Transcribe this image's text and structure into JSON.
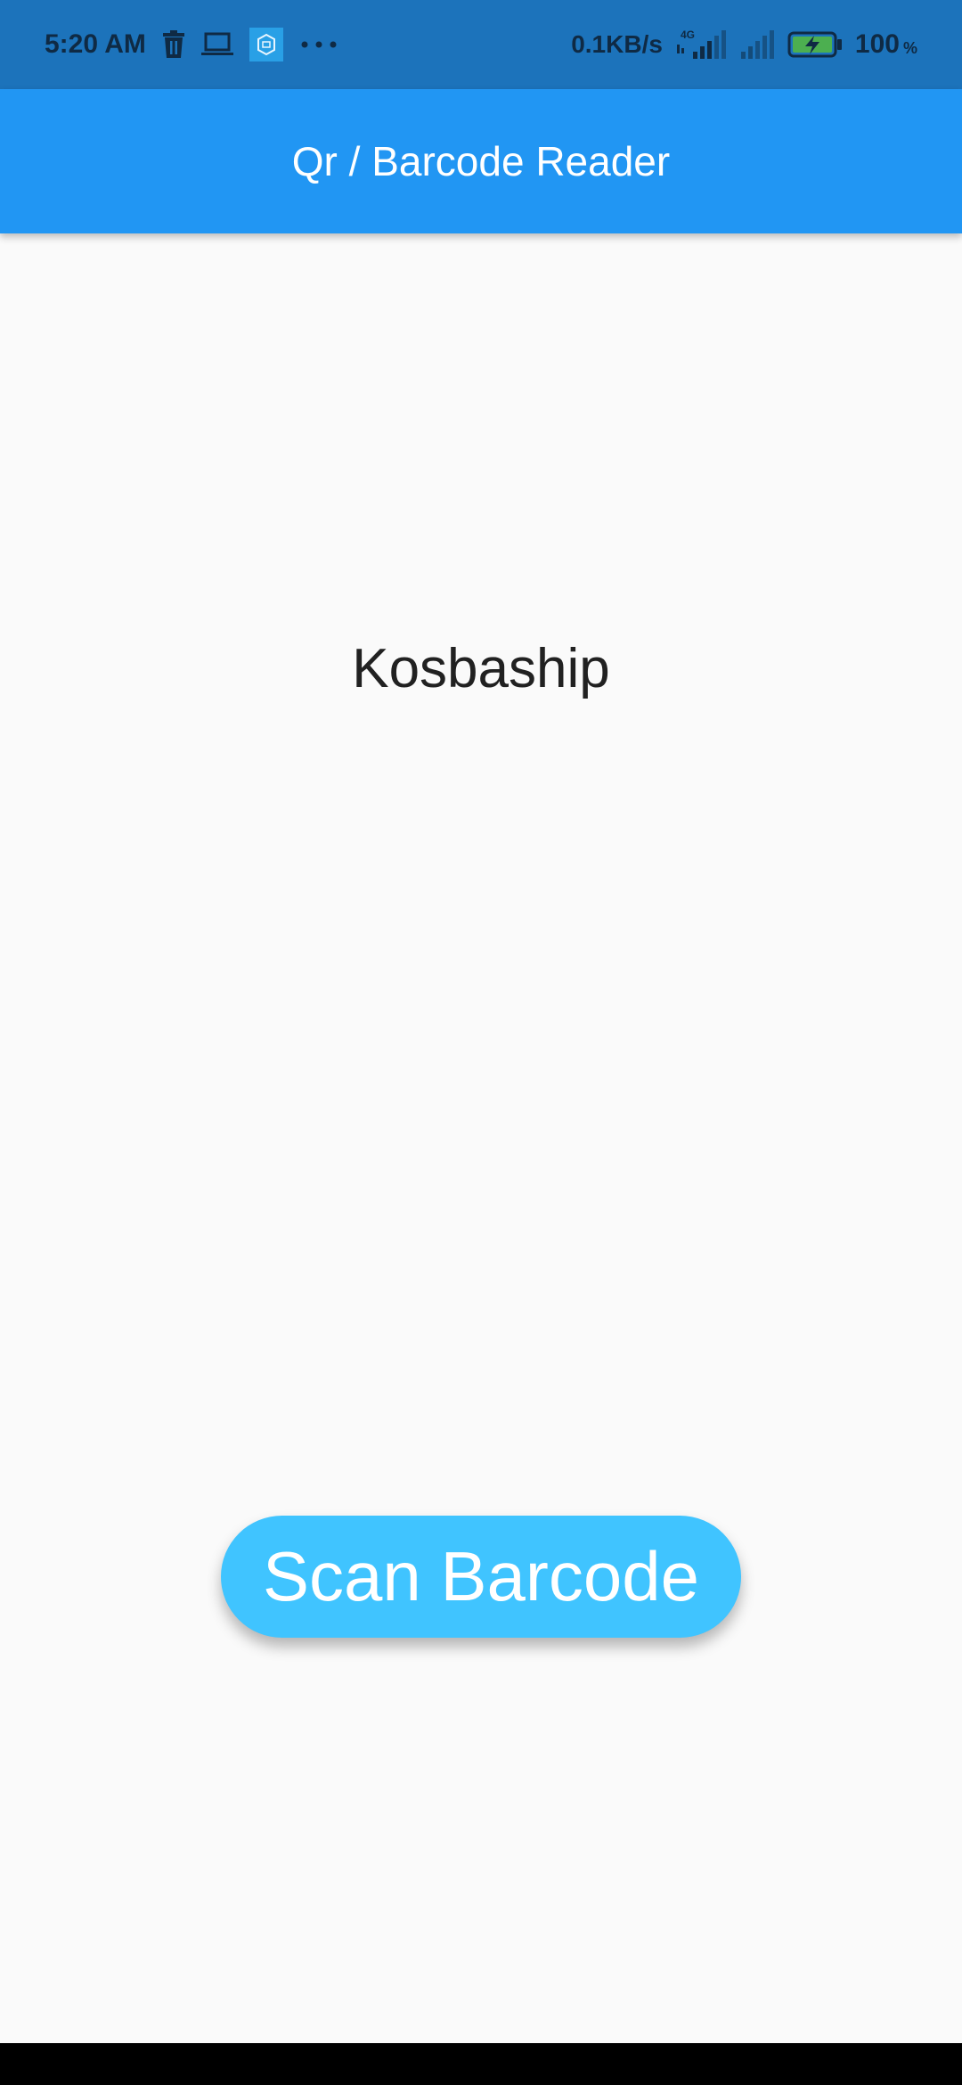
{
  "status_bar": {
    "time": "5:20 AM",
    "network_speed": "0.1KB/s",
    "network_type": "4G",
    "battery_level": "100",
    "battery_unit": "%",
    "icons": [
      "trash-icon",
      "laptop-icon",
      "app-notification-icon",
      "more-dots-icon",
      "signal-4g-icon",
      "signal-icon",
      "battery-charging-icon"
    ],
    "background": "#1c73bb"
  },
  "app_bar": {
    "title": "Qr / Barcode Reader",
    "color": "#2196f3"
  },
  "main": {
    "result_text": "Kosbaship",
    "scan_button_label": "Scan Barcode",
    "scan_button_color": "#40c4ff"
  }
}
